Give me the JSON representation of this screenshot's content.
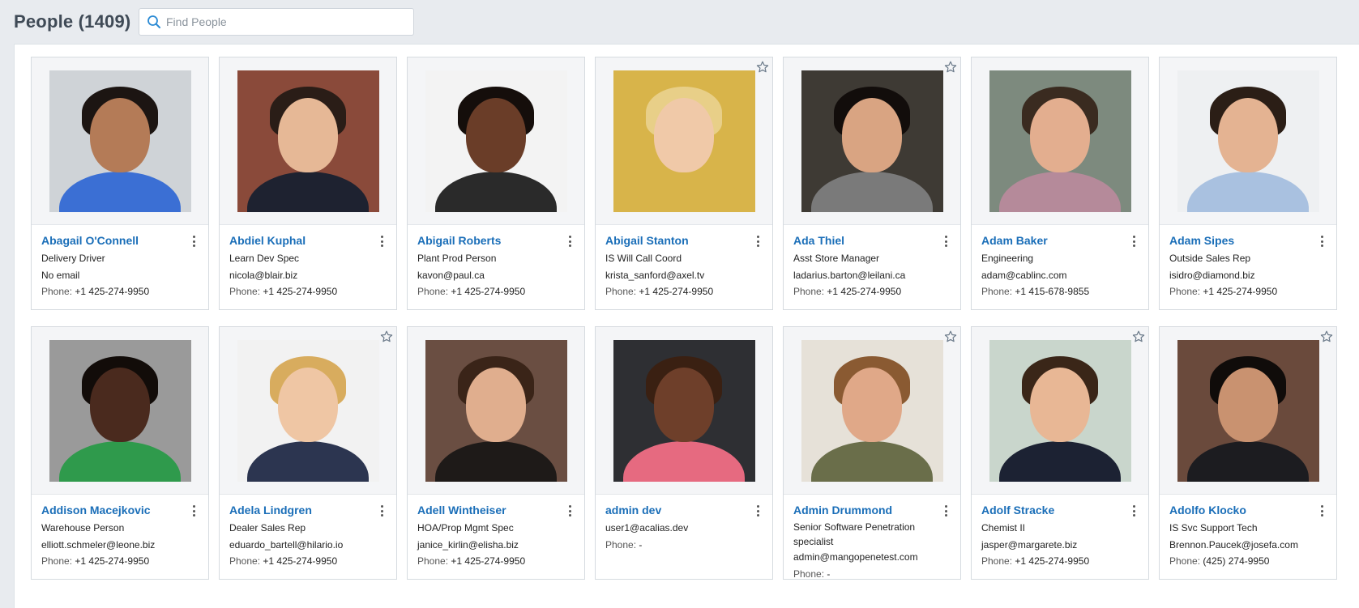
{
  "header": {
    "title": "People (1409)"
  },
  "search": {
    "placeholder": "Find People",
    "value": ""
  },
  "colors": {
    "link": "#1a6eb8",
    "background": "#e8ebef",
    "star": "#6b7a8a"
  },
  "people": [
    {
      "name": "Abagail O'Connell",
      "title": "Delivery Driver",
      "email": "No email",
      "phone_label": "Phone:",
      "phone": "+1 425-274-9950",
      "favorite": false,
      "bg": "#cfd3d7",
      "skin": "#b47b57",
      "hair": "#1c1512",
      "shirt": "#3b6fd4"
    },
    {
      "name": "Abdiel Kuphal",
      "title": "Learn Dev Spec",
      "email": "nicola@blair.biz",
      "phone_label": "Phone:",
      "phone": "+1 425-274-9950",
      "favorite": false,
      "bg": "#8a4a3a",
      "skin": "#e6b896",
      "hair": "#2a1d17",
      "shirt": "#1e2230"
    },
    {
      "name": "Abigail Roberts",
      "title": "Plant Prod Person",
      "email": "kavon@paul.ca",
      "phone_label": "Phone:",
      "phone": "+1 425-274-9950",
      "favorite": false,
      "bg": "#f3f3f3",
      "skin": "#6a3d28",
      "hair": "#150e0b",
      "shirt": "#2a2a2a"
    },
    {
      "name": "Abigail Stanton",
      "title": "IS Will Call Coord",
      "email": "krista_sanford@axel.tv",
      "phone_label": "Phone:",
      "phone": "+1 425-274-9950",
      "favorite": true,
      "bg": "#d8b44a",
      "skin": "#f0c9a8",
      "hair": "#e8cf88",
      "shirt": "#d8b44a"
    },
    {
      "name": "Ada Thiel",
      "title": "Asst Store Manager",
      "email": "ladarius.barton@leilani.ca",
      "phone_label": "Phone:",
      "phone": "+1 425-274-9950",
      "favorite": true,
      "bg": "#3e3a34",
      "skin": "#d9a482",
      "hair": "#120d0b",
      "shirt": "#7a7a7a"
    },
    {
      "name": "Adam Baker",
      "title": "Engineering",
      "email": "adam@cablinc.com",
      "phone_label": "Phone:",
      "phone": "+1 415-678-9855",
      "favorite": false,
      "bg": "#7d8a7e",
      "skin": "#e3ae8f",
      "hair": "#3a2b20",
      "shirt": "#b58a9a"
    },
    {
      "name": "Adam Sipes",
      "title": "Outside Sales Rep",
      "email": "isidro@diamond.biz",
      "phone_label": "Phone:",
      "phone": "+1 425-274-9950",
      "favorite": false,
      "bg": "#eef0f2",
      "skin": "#e4b392",
      "hair": "#2b1e16",
      "shirt": "#a9c1e0"
    },
    {
      "name": "Addison Macejkovic",
      "title": "Warehouse Person",
      "email": "elliott.schmeler@leone.biz",
      "phone_label": "Phone:",
      "phone": "+1 425-274-9950",
      "favorite": false,
      "bg": "#9a9a9a",
      "skin": "#4a2a1e",
      "hair": "#120c09",
      "shirt": "#2f9a4c"
    },
    {
      "name": "Adela Lindgren",
      "title": "Dealer Sales Rep",
      "email": "eduardo_bartell@hilario.io",
      "phone_label": "Phone:",
      "phone": "+1 425-274-9950",
      "favorite": true,
      "bg": "#f2f2f2",
      "skin": "#efc6a4",
      "hair": "#d8ac5e",
      "shirt": "#2c3550"
    },
    {
      "name": "Adell Wintheiser",
      "title": "HOA/Prop Mgmt Spec",
      "email": "janice_kirlin@elisha.biz",
      "phone_label": "Phone:",
      "phone": "+1 425-274-9950",
      "favorite": false,
      "bg": "#6a4e42",
      "skin": "#e0ae8e",
      "hair": "#3a2418",
      "shirt": "#1e1a18"
    },
    {
      "name": "admin dev",
      "title": "",
      "email": "user1@acalias.dev",
      "phone_label": "Phone:",
      "phone": "-",
      "favorite": false,
      "bg": "#2e2f33",
      "skin": "#6e3f2a",
      "hair": "#3a2012",
      "shirt": "#e66a80"
    },
    {
      "name": "Admin Drummond",
      "title": "Senior Software Penetration specialist",
      "email": "admin@mangopenetest.com",
      "phone_label": "Phone:",
      "phone": "-",
      "favorite": true,
      "bg": "#e6e1d8",
      "skin": "#e0a888",
      "hair": "#8a5a32",
      "shirt": "#6a6e4a"
    },
    {
      "name": "Adolf Stracke",
      "title": "Chemist II",
      "email": "jasper@margarete.biz",
      "phone_label": "Phone:",
      "phone": "+1 425-274-9950",
      "favorite": true,
      "bg": "#c9d6cc",
      "skin": "#e8b795",
      "hair": "#3a2618",
      "shirt": "#1c2233"
    },
    {
      "name": "Adolfo Klocko",
      "title": "IS Svc Support Tech",
      "email": "Brennon.Paucek@josefa.com",
      "phone_label": "Phone:",
      "phone": "(425) 274-9950",
      "favorite": true,
      "bg": "#6a4a3c",
      "skin": "#c99270",
      "hair": "#100c0a",
      "shirt": "#1c1c20"
    }
  ]
}
